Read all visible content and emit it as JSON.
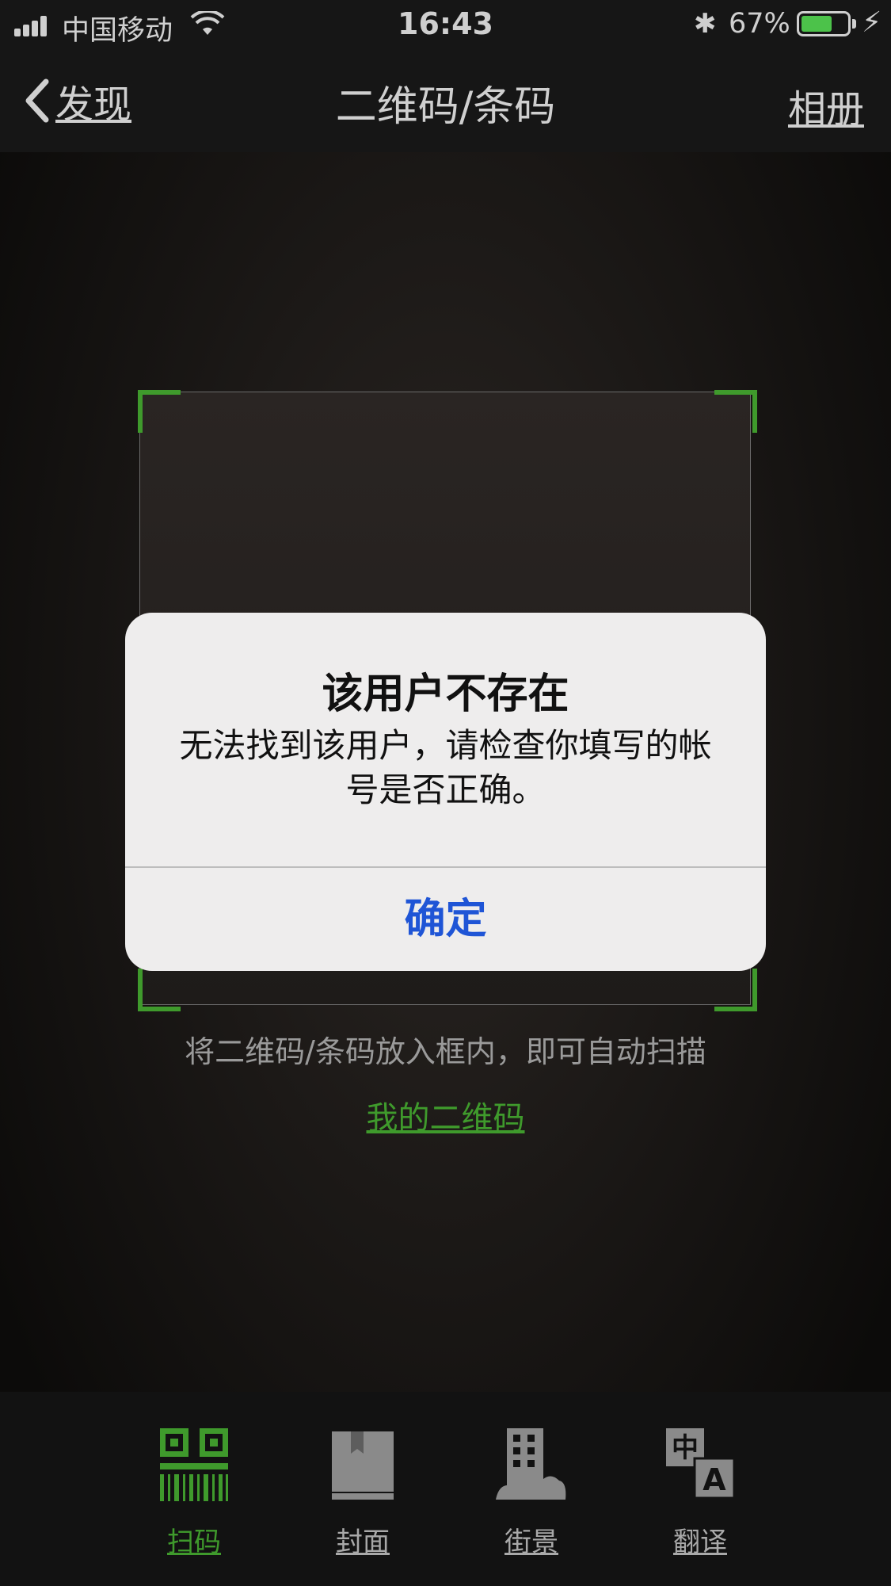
{
  "status_bar": {
    "carrier": "中国移动",
    "time": "16:43",
    "battery_percent_text": "67%",
    "battery_level": 0.67,
    "icons": [
      "signal-icon",
      "wifi-icon",
      "bluetooth-icon",
      "battery-icon",
      "charging-icon"
    ]
  },
  "nav": {
    "back_label": "发现",
    "title": "二维码/条码",
    "album_label": "相册"
  },
  "scanner": {
    "hint": "将二维码/条码放入框内，即可自动扫描",
    "my_qr_link": "我的二维码",
    "accent_color": "#3f9a2c"
  },
  "alert": {
    "title": "该用户不存在",
    "message": "无法找到该用户，请检查你填写的帐号是否正确。",
    "confirm_label": "确定",
    "confirm_color": "#1f55d6"
  },
  "tabs": [
    {
      "label": "扫码",
      "icon": "qr-scan-icon",
      "active": true
    },
    {
      "label": "封面",
      "icon": "book-cover-icon",
      "active": false
    },
    {
      "label": "街景",
      "icon": "street-view-icon",
      "active": false
    },
    {
      "label": "翻译",
      "icon": "translate-icon",
      "active": false
    }
  ]
}
